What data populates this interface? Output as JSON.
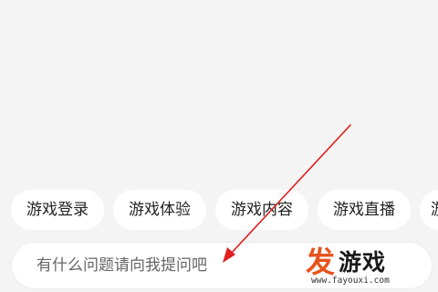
{
  "chips": [
    {
      "label": "游戏登录"
    },
    {
      "label": "游戏体验"
    },
    {
      "label": "游戏内容"
    },
    {
      "label": "游戏直播"
    },
    {
      "label": "游"
    }
  ],
  "input": {
    "placeholder": "有什么问题请向我提问吧"
  },
  "watermark": {
    "brand_char": "发",
    "brand_text": "游戏",
    "url": "www.fayouxi.com"
  },
  "annotation": {
    "icon": "red-arrow-icon",
    "color": "#e02020"
  },
  "colors": {
    "background": "#f4f4f4",
    "chip_bg": "#ffffff",
    "accent": "#e8531d"
  }
}
